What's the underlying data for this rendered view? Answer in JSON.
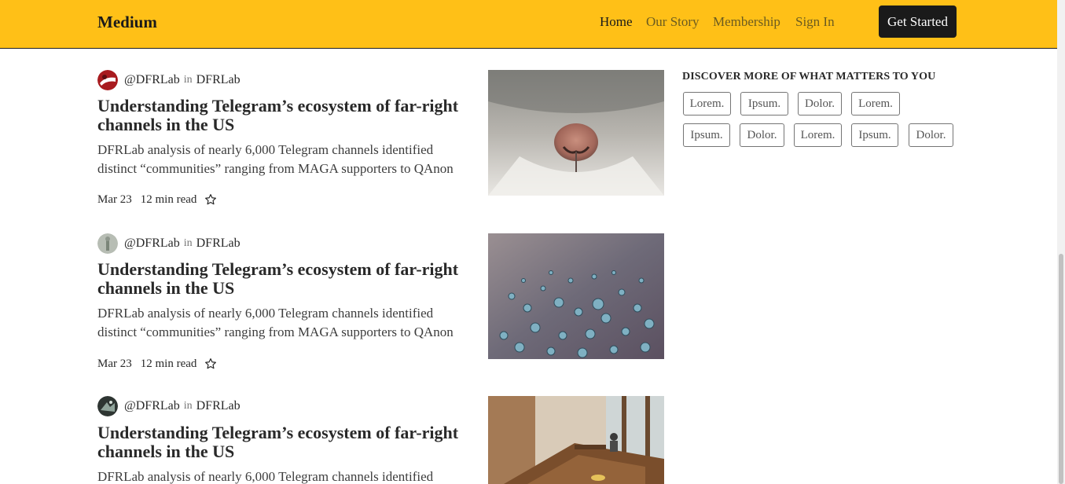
{
  "header": {
    "brand": "Medium",
    "nav": [
      {
        "label": "Home",
        "active": true
      },
      {
        "label": "Our Story",
        "active": false
      },
      {
        "label": "Membership",
        "active": false
      },
      {
        "label": "Sign In",
        "active": false
      }
    ],
    "cta_label": "Get Started",
    "colors": {
      "background": "#ffc017",
      "cta_background": "#1a1a1a"
    }
  },
  "articles": [
    {
      "author": "@DFRLab",
      "in_word": "in",
      "publication": "DFRLab",
      "title": "Understanding Telegram’s ecosystem of far-right channels in the US",
      "description": "DFRLab analysis of nearly 6,000 Telegram channels identified distinct “communities” ranging from MAGA supporters to QAnon",
      "date": "Mar 23",
      "read_time": "12 min read",
      "image": "cat-nose-closeup"
    },
    {
      "author": "@DFRLab",
      "in_word": "in",
      "publication": "DFRLab",
      "title": "Understanding Telegram’s ecosystem of far-right channels in the US",
      "description": "DFRLab analysis of nearly 6,000 Telegram channels identified distinct “communities” ranging from MAGA supporters to QAnon",
      "date": "Mar 23",
      "read_time": "12 min read",
      "image": "water-droplets"
    },
    {
      "author": "@DFRLab",
      "in_word": "in",
      "publication": "DFRLab",
      "title": "Understanding Telegram’s ecosystem of far-right channels in the US",
      "description": "DFRLab analysis of nearly 6,000 Telegram channels identified",
      "image": "cafe-interior"
    }
  ],
  "sidebar": {
    "heading": "DISCOVER MORE OF WHAT MATTERS TO YOU",
    "tags_row1": [
      "Lorem.",
      "Ipsum.",
      "Dolor.",
      "Lorem."
    ],
    "tags_row2": [
      "Ipsum.",
      "Dolor.",
      "Lorem.",
      "Ipsum.",
      "Dolor."
    ]
  }
}
